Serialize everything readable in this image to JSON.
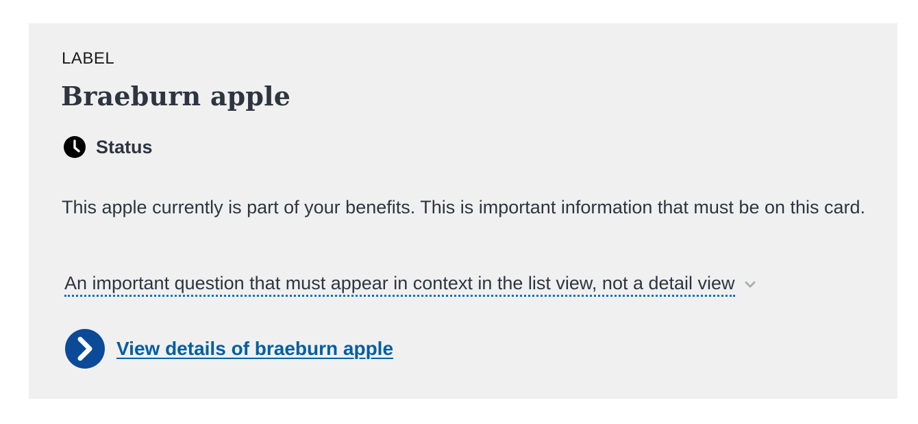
{
  "card": {
    "label": "LABEL",
    "title": "Braeburn apple",
    "status": {
      "icon": "clock-icon",
      "text": "Status"
    },
    "description": "This apple currently is part of your benefits. This is important information that must be on this card.",
    "question": {
      "text": "An important question that must appear in context in the list view, not a detail view",
      "icon": "chevron-down-icon"
    },
    "details_link": {
      "icon": "arrow-circle-right-icon",
      "text": "View details of braeburn apple"
    }
  },
  "colors": {
    "card_background": "#f0f0f0",
    "text_primary": "#2e3440",
    "link": "#005ea2",
    "icon_circle": "#0b4a96",
    "dotted_underline": "#0071bb"
  }
}
